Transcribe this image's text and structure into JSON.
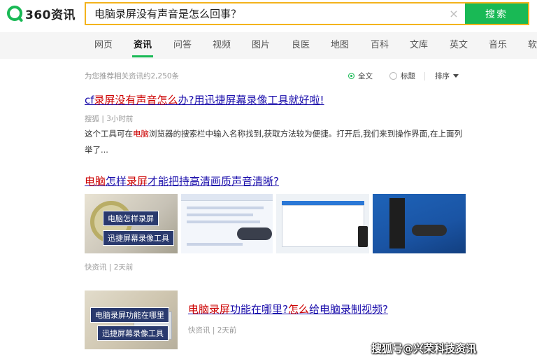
{
  "header": {
    "logo_text": "360资讯",
    "search_value": "电脑录屏没有声音是怎么回事？",
    "clear_icon": "×",
    "search_button": "搜索",
    "brand_color": "#19b955",
    "search_border_color": "#f3b31c"
  },
  "tabs": [
    {
      "label": "网页"
    },
    {
      "label": "资讯",
      "active": true
    },
    {
      "label": "问答"
    },
    {
      "label": "视频"
    },
    {
      "label": "图片"
    },
    {
      "label": "良医"
    },
    {
      "label": "地图"
    },
    {
      "label": "百科"
    },
    {
      "label": "文库"
    },
    {
      "label": "英文"
    },
    {
      "label": "音乐"
    },
    {
      "label": "软"
    }
  ],
  "meta": {
    "result_count": "为您推荐相关资讯约2,250条",
    "filter_all": "全文",
    "filter_title": "标题",
    "sort": "排序"
  },
  "results": [
    {
      "title_parts": [
        "cf",
        "录屏没有声音怎么",
        "办?用迅捷屏幕录像工具就好啦!"
      ],
      "source": "搜狐 | 3小时前",
      "snippet_parts": [
        "这个工具可在",
        "电脑",
        "浏览器的搜索栏中输入名称找到,获取方法较为便捷。打开后,我们来到操作界面,在上面列举了..."
      ]
    },
    {
      "title_parts": [
        "电脑",
        "怎样",
        "录屏",
        "才能把持高清画质声音清晰?"
      ],
      "source": "快资讯 | 2天前",
      "thumb1_label1": "电脑怎样录屏",
      "thumb1_label2": "迅捷屏幕录像工具"
    },
    {
      "title_parts": [
        "电脑录屏",
        "功能在哪里?",
        "怎么",
        "给电脑录制视频?"
      ],
      "source": "快资讯 | 2天前",
      "thumb_label1": "电脑录屏功能在哪里",
      "thumb_label2": "迅捷屏幕录像工具"
    }
  ],
  "watermark": "搜狐号@兴荣科技资讯"
}
